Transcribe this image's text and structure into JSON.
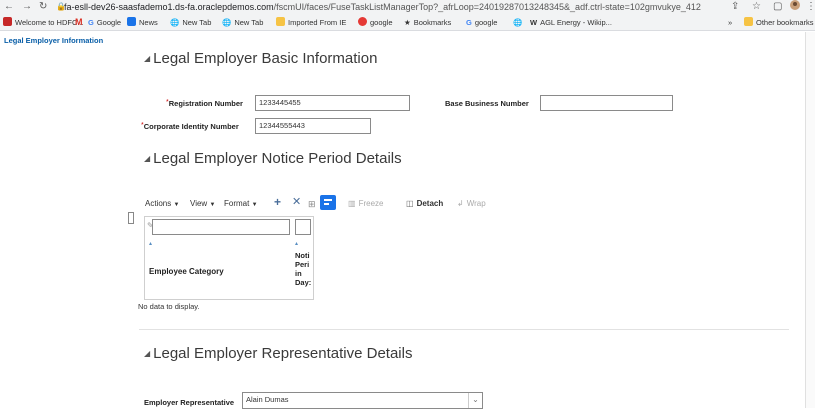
{
  "browser": {
    "url_host": "fa-esll-dev26-saasfademo1.ds-fa.oraclepdemos.com",
    "url_path": "/fscmUI/faces/FuseTaskListManagerTop?_afrLoop=24019287013248345&_adf.ctrl-state=102gmvukye_412",
    "bookmarks": [
      "Welcome to HDFC...",
      "Gmail",
      "Google",
      "News",
      "New Tab",
      "New Tab",
      "Imported From IE",
      "google",
      "Bookmarks",
      "google",
      "",
      "AGL Energy - Wikip..."
    ],
    "overflow": "»",
    "other_bookmarks": "Other bookmarks",
    "colors": {
      "chrome": "#f2f3f4",
      "link": "#0a5fa8",
      "accent_blue": "#1a73e8"
    }
  },
  "nav": {
    "left_title": "Legal Employer Information"
  },
  "section_basic": {
    "title": "Legal Employer Basic Information",
    "registration_label": "Registration Number",
    "registration_value": "1233445455",
    "base_business_label": "Base Business Number",
    "base_business_value": "",
    "corporate_label": "Corporate Identity Number",
    "corporate_value": "12344555443"
  },
  "section_notice": {
    "title": "Legal Employer Notice Period Details",
    "toolbar": {
      "actions": "Actions",
      "view": "View",
      "format": "Format",
      "freeze": "Freeze",
      "detach": "Detach",
      "wrap": "Wrap"
    },
    "columns": {
      "employee_category": "Employee Category",
      "notice_lines": [
        "Noti",
        "Peri",
        "in",
        "Day:"
      ]
    },
    "empty_text": "No data to display."
  },
  "section_rep": {
    "title": "Legal Employer Representative Details",
    "employer_rep_label": "Employer Representative",
    "employer_rep_value": "Alain Dumas"
  }
}
